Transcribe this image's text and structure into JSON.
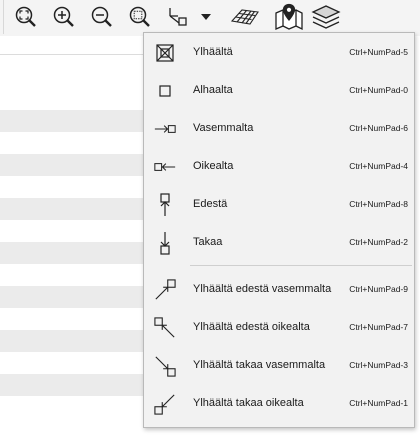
{
  "toolbar": {
    "buttons": [
      {
        "icon": "zoom-extents-icon"
      },
      {
        "icon": "zoom-in-icon"
      },
      {
        "icon": "zoom-out-icon"
      },
      {
        "icon": "zoom-window-icon"
      },
      {
        "icon": "view-direction-icon"
      },
      {
        "icon": "dropdown-arrow-icon"
      },
      {
        "icon": "grid-plane-icon"
      },
      {
        "icon": "map-pin-icon"
      },
      {
        "icon": "layers-icon"
      }
    ]
  },
  "menu": {
    "items": [
      {
        "label": "Ylhäältä",
        "shortcut": "Ctrl+NumPad-5",
        "icon": "view-top-icon"
      },
      {
        "label": "Alhaalta",
        "shortcut": "Ctrl+NumPad-0",
        "icon": "view-bottom-icon"
      },
      {
        "label": "Vasemmalta",
        "shortcut": "Ctrl+NumPad-6",
        "icon": "view-left-icon"
      },
      {
        "label": "Oikealta",
        "shortcut": "Ctrl+NumPad-4",
        "icon": "view-right-icon"
      },
      {
        "label": "Edestä",
        "shortcut": "Ctrl+NumPad-8",
        "icon": "view-front-icon"
      },
      {
        "label": "Takaa",
        "shortcut": "Ctrl+NumPad-2",
        "icon": "view-back-icon"
      },
      {
        "label": "Ylhäältä edestä vasemmalta",
        "shortcut": "Ctrl+NumPad-9",
        "icon": "view-top-front-left-icon"
      },
      {
        "label": "Ylhäältä edestä oikealta",
        "shortcut": "Ctrl+NumPad-7",
        "icon": "view-top-front-right-icon"
      },
      {
        "label": "Ylhäältä takaa vasemmalta",
        "shortcut": "Ctrl+NumPad-3",
        "icon": "view-top-back-left-icon"
      },
      {
        "label": "Ylhäältä takaa oikealta",
        "shortcut": "Ctrl+NumPad-1",
        "icon": "view-top-back-right-icon"
      }
    ]
  }
}
